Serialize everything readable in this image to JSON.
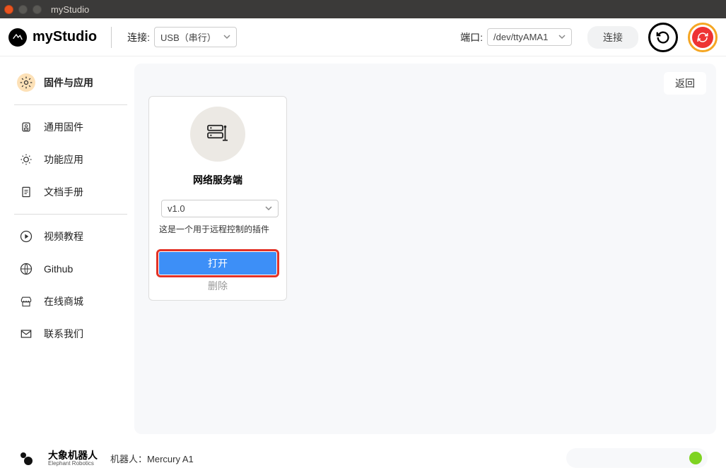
{
  "window": {
    "title": "myStudio"
  },
  "header": {
    "app_name": "myStudio",
    "connection_label": "连接:",
    "connection_value": "USB（串行）",
    "port_label": "端口:",
    "port_value": "/dev/ttyAMA1",
    "connect_button": "连接"
  },
  "sidebar": {
    "items": [
      {
        "label": "固件与应用",
        "icon": "gear"
      },
      {
        "label": "通用固件",
        "icon": "chip"
      },
      {
        "label": "功能应用",
        "icon": "cog"
      },
      {
        "label": "文档手册",
        "icon": "doc"
      },
      {
        "label": "视频教程",
        "icon": "play"
      },
      {
        "label": "Github",
        "icon": "globe"
      },
      {
        "label": "在线商城",
        "icon": "shop"
      },
      {
        "label": "联系我们",
        "icon": "mail"
      }
    ]
  },
  "content": {
    "back_button": "返回",
    "card": {
      "title": "网络服务端",
      "version": "v1.0",
      "description": "这是一个用于远程控制的插件",
      "open_button": "打开",
      "delete_button": "删除"
    }
  },
  "footer": {
    "brand_zh": "大象机器人",
    "brand_en": "Elephant Robotics",
    "robot_label": "机器人：",
    "robot_value": "Mercury A1"
  }
}
